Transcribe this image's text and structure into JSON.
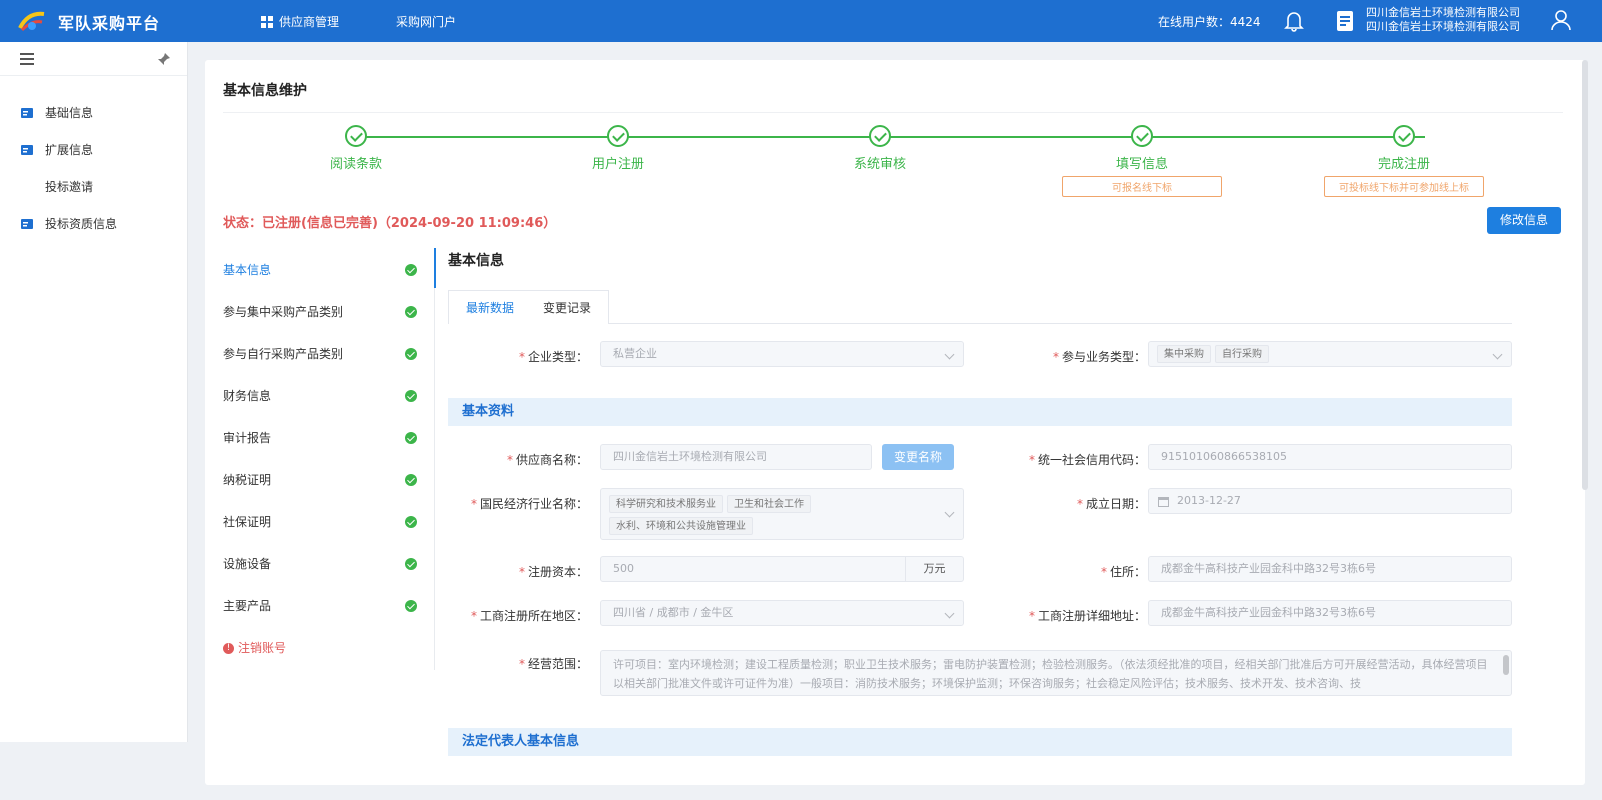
{
  "header": {
    "app_title": "军队采购平台",
    "nav": [
      "供应商管理",
      "采购网门户"
    ],
    "online_users": "在线用户数：4424",
    "company_line1": "四川金信岩土环境检测有限公司",
    "company_line2": "四川金信岩土环境检测有限公司"
  },
  "sidebar": {
    "items": [
      {
        "label": "基础信息",
        "icon": "card-icon"
      },
      {
        "label": "扩展信息",
        "icon": "card-icon"
      },
      {
        "label": "投标邀请",
        "icon": ""
      },
      {
        "label": "投标资质信息",
        "icon": "card-icon"
      }
    ]
  },
  "page": {
    "title": "基本信息维护",
    "steps": [
      {
        "label": "阅读条款",
        "tag": ""
      },
      {
        "label": "用户注册",
        "tag": ""
      },
      {
        "label": "系统审核",
        "tag": ""
      },
      {
        "label": "填写信息",
        "tag": "可报名线下标"
      },
      {
        "label": "完成注册",
        "tag": "可投标线下标并可参加线上标"
      }
    ],
    "status": "状态：已注册(信息已完善)（2024-09-20 11:09:46）",
    "edit_button": "修改信息"
  },
  "subnav": {
    "items": [
      {
        "label": "基本信息",
        "done": true,
        "active": true
      },
      {
        "label": "参与集中采购产品类别",
        "done": true
      },
      {
        "label": "参与自行采购产品类别",
        "done": true
      },
      {
        "label": "财务信息",
        "done": true
      },
      {
        "label": "审计报告",
        "done": true
      },
      {
        "label": "纳税证明",
        "done": true
      },
      {
        "label": "社保证明",
        "done": true
      },
      {
        "label": "设施设备",
        "done": true
      },
      {
        "label": "主要产品",
        "done": true
      }
    ],
    "cancel_account": "注销账号"
  },
  "content": {
    "section_title": "基本信息",
    "tabs": [
      "最新数据",
      "变更记录"
    ],
    "enterprise_type_label": "企业类型：",
    "enterprise_type": "私营企业",
    "business_type_label": "参与业务类型：",
    "business_types": [
      "集中采购",
      "自行采购"
    ],
    "band_basic": "基本资料",
    "supplier_name_label": "供应商名称：",
    "supplier_name": "四川金信岩土环境检测有限公司",
    "rename_button": "变更名称",
    "credit_code_label": "统一社会信用代码：",
    "credit_code": "915101060866538105",
    "industry_label": "国民经济行业名称：",
    "industries": [
      "科学研究和技术服务业",
      "卫生和社会工作",
      "水利、环境和公共设施管理业"
    ],
    "founded_label": "成立日期：",
    "founded": "2013-12-27",
    "capital_label": "注册资本：",
    "capital": "500",
    "capital_unit": "万元",
    "address_label": "住所：",
    "address": "成都金牛高科技产业园金科中路32号3栋6号",
    "region_label": "工商注册所在地区：",
    "region": "四川省 / 成都市 / 金牛区",
    "reg_address_label": "工商注册详细地址：",
    "reg_address": "成都金牛高科技产业园金科中路32号3栋6号",
    "scope_label": "经营范围：",
    "scope": "许可项目：室内环境检测；建设工程质量检测；职业卫生技术服务；雷电防护装置检测；检验检测服务。（依法须经批准的项目，经相关部门批准后方可开展经营活动，具体经营项目以相关部门批准文件或许可证件为准）一般项目：消防技术服务；环境保护监测；环保咨询服务；社会稳定风险评估；技术服务、技术开发、技术咨询、技",
    "band_legal": "法定代表人基本信息"
  }
}
